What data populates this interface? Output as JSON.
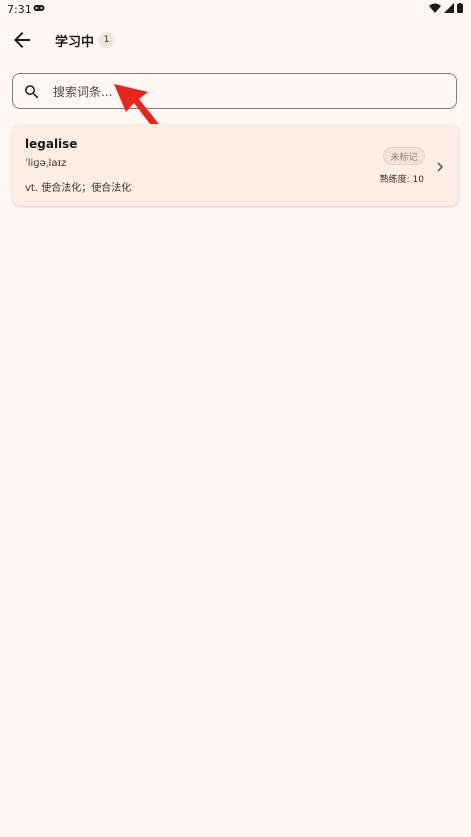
{
  "status_bar": {
    "time": "7:31",
    "game_icon": "gamepad-icon",
    "wifi_icon": "wifi-icon",
    "signal_icon": "signal-icon",
    "battery_icon": "battery-icon"
  },
  "header": {
    "back_icon": "arrow-left-icon",
    "title": "学习中",
    "count": "1"
  },
  "search": {
    "icon": "search-icon",
    "placeholder": "搜索词条..."
  },
  "words": [
    {
      "word": "legalise",
      "phonetic": "ˈliɡəˌlaɪz",
      "meaning": "vt. 使合法化；使合法化",
      "tag": "未标记",
      "proficiency": "熟练度: 10"
    }
  ],
  "colors": {
    "background": "#fff8f5",
    "card": "#fdeee3",
    "annotation_arrow": "#e8251b"
  }
}
